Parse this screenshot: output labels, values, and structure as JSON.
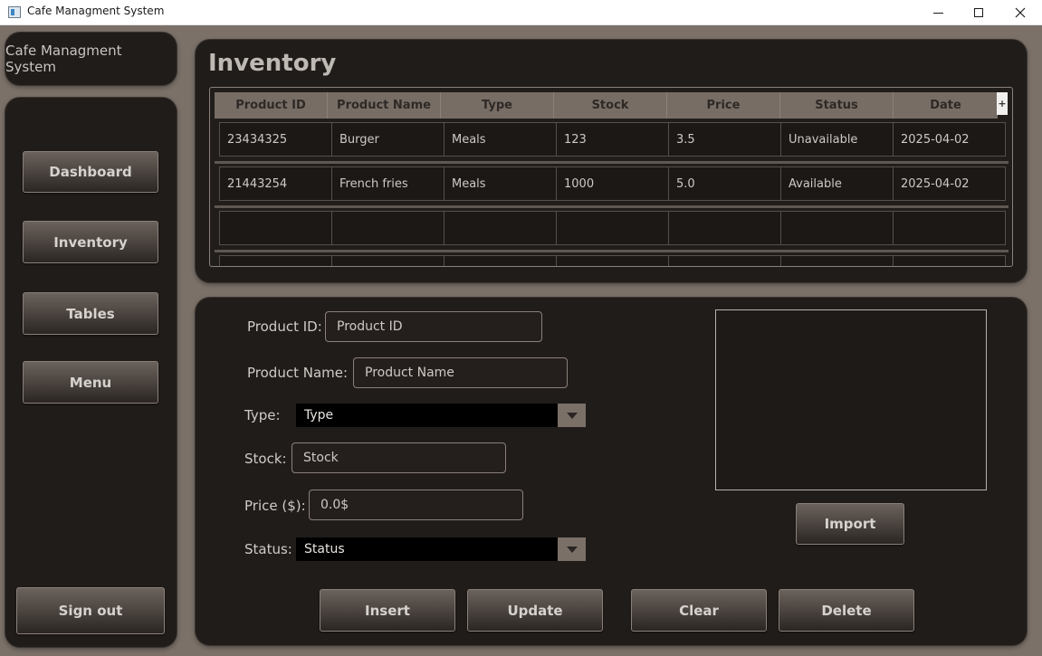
{
  "window": {
    "title": "Cafe Managment System",
    "icon": "app-window-icon"
  },
  "sidebar": {
    "brand": "Cafe Managment System",
    "items": [
      {
        "label": "Dashboard"
      },
      {
        "label": "Inventory"
      },
      {
        "label": "Tables"
      },
      {
        "label": "Menu"
      }
    ],
    "signout_label": "Sign out"
  },
  "inventory": {
    "title": "Inventory",
    "columns": [
      "Product ID",
      "Product Name",
      "Type",
      "Stock",
      "Price",
      "Status",
      "Date"
    ],
    "add_column_symbol": "+",
    "rows": [
      [
        "23434325",
        "Burger",
        "Meals",
        "123",
        "3.5",
        "Unavailable",
        "2025-04-02"
      ],
      [
        "21443254",
        "French fries",
        "Meals",
        "1000",
        "5.0",
        "Available",
        "2025-04-02"
      ],
      [
        "",
        "",
        "",
        "",
        "",
        "",
        ""
      ],
      [
        "",
        "",
        "",
        "",
        "",
        "",
        ""
      ]
    ]
  },
  "form": {
    "product_id": {
      "label": "Product ID:",
      "placeholder": "Product ID"
    },
    "product_name": {
      "label": "Product Name:",
      "placeholder": "Product Name"
    },
    "type": {
      "label": "Type:",
      "value": "Type"
    },
    "stock": {
      "label": "Stock:",
      "placeholder": "Stock"
    },
    "price": {
      "label": "Price ($):",
      "placeholder": "0.0$"
    },
    "status": {
      "label": "Status:",
      "value": "Status"
    }
  },
  "actions": {
    "import": "Import",
    "insert": "Insert",
    "update": "Update",
    "clear": "Clear",
    "delete": "Delete"
  }
}
